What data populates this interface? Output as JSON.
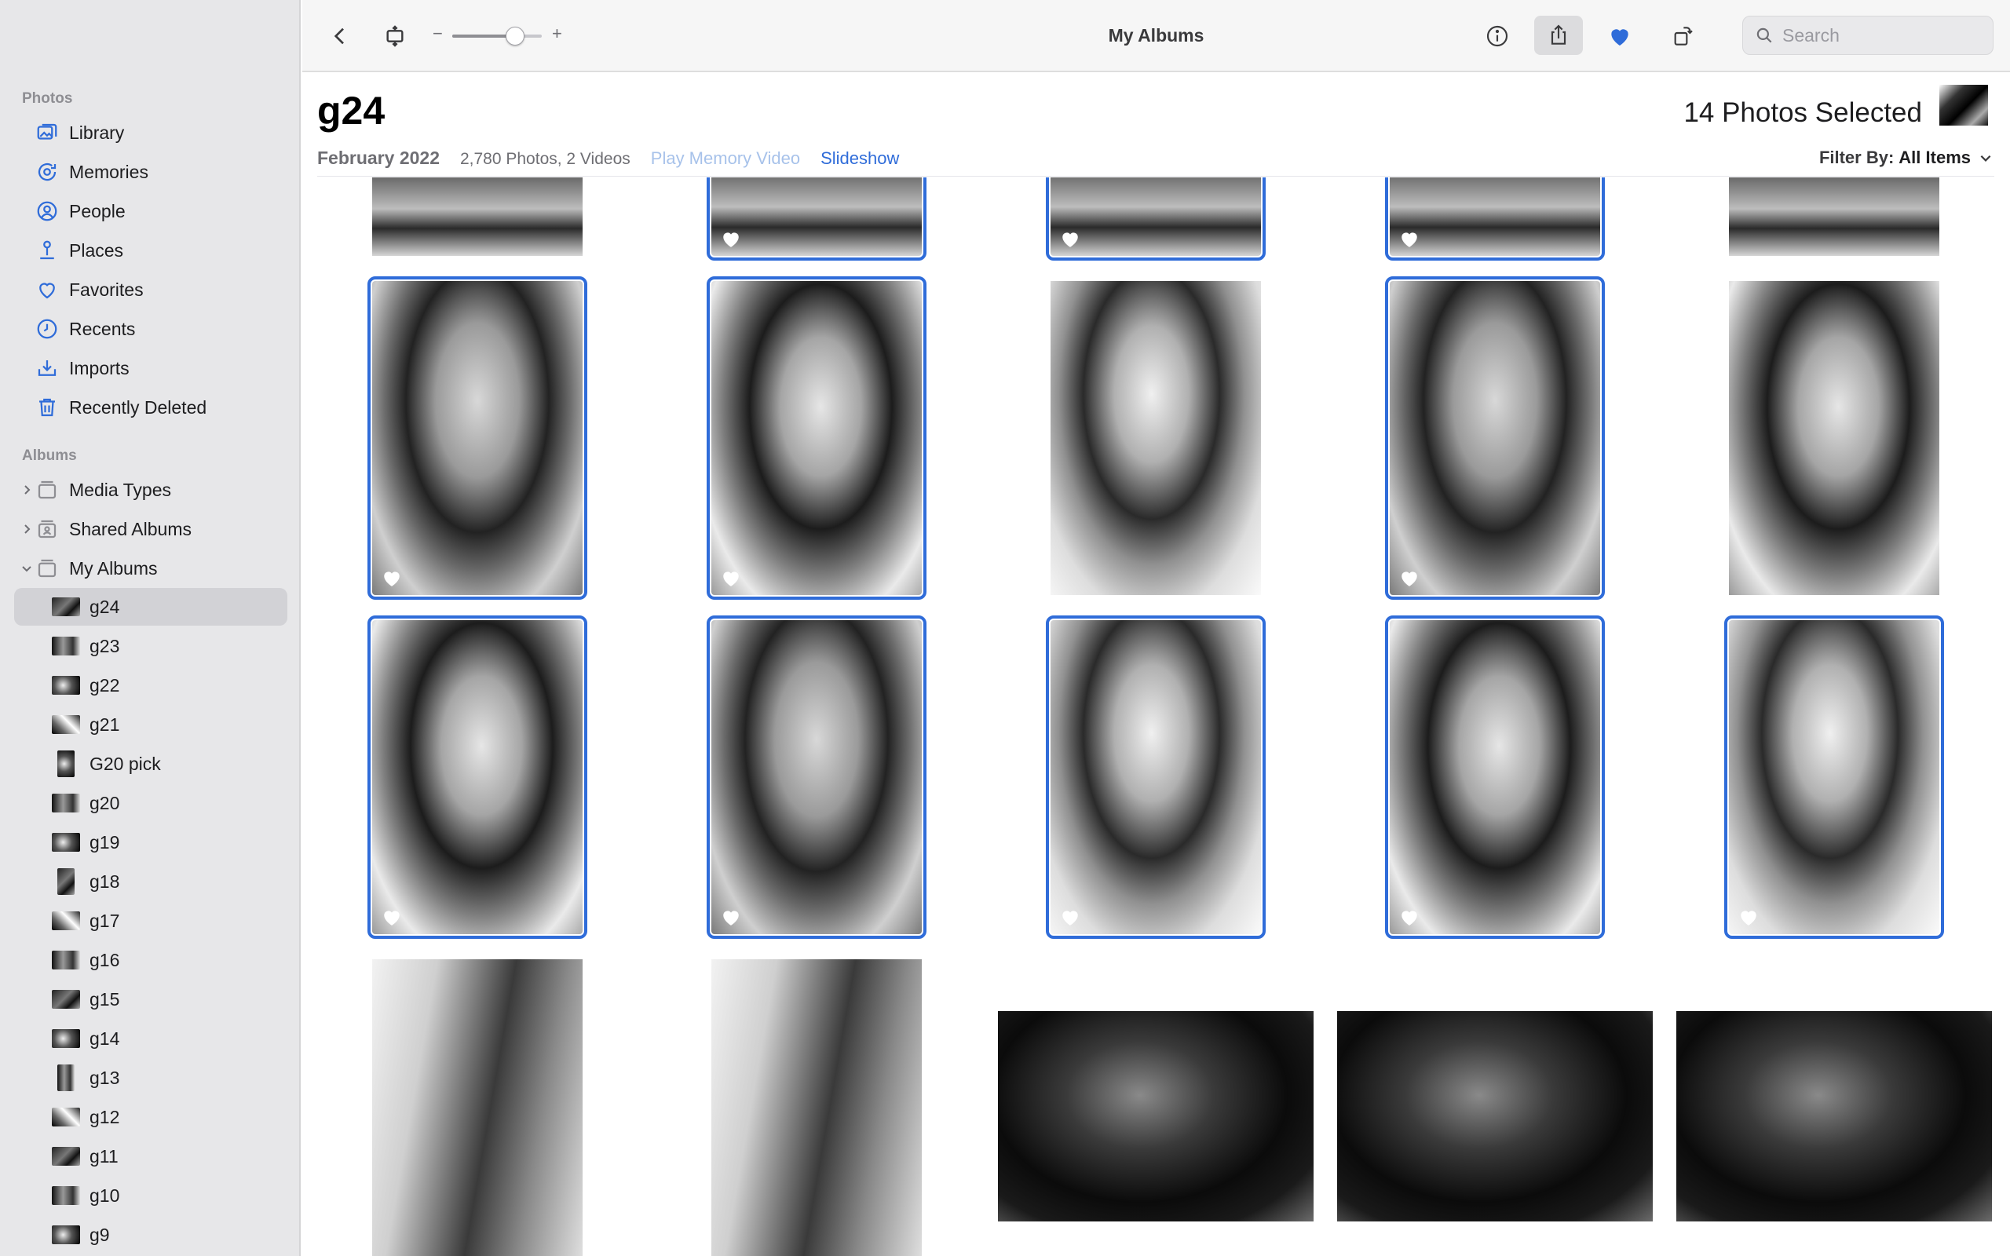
{
  "window": {
    "title": "My Albums"
  },
  "sidebar": {
    "photos_section": "Photos",
    "photos_items": [
      {
        "label": "Library",
        "icon": "library-icon"
      },
      {
        "label": "Memories",
        "icon": "memories-icon"
      },
      {
        "label": "People",
        "icon": "people-icon"
      },
      {
        "label": "Places",
        "icon": "places-icon"
      },
      {
        "label": "Favorites",
        "icon": "heart-icon"
      },
      {
        "label": "Recents",
        "icon": "clock-icon"
      },
      {
        "label": "Imports",
        "icon": "import-icon"
      },
      {
        "label": "Recently Deleted",
        "icon": "trash-icon"
      }
    ],
    "albums_section": "Albums",
    "album_groups": [
      {
        "label": "Media Types",
        "expanded": false
      },
      {
        "label": "Shared Albums",
        "expanded": false
      },
      {
        "label": "My Albums",
        "expanded": true
      }
    ],
    "my_albums": [
      {
        "label": "g24",
        "selected": true
      },
      {
        "label": "g23"
      },
      {
        "label": "g22"
      },
      {
        "label": "g21"
      },
      {
        "label": "G20 pick"
      },
      {
        "label": "g20"
      },
      {
        "label": "g19"
      },
      {
        "label": "g18"
      },
      {
        "label": "g17"
      },
      {
        "label": "g16"
      },
      {
        "label": "g15"
      },
      {
        "label": "g14"
      },
      {
        "label": "g13"
      },
      {
        "label": "g12"
      },
      {
        "label": "g11"
      },
      {
        "label": "g10"
      },
      {
        "label": "g9"
      }
    ]
  },
  "toolbar": {
    "zoom_minus": "−",
    "zoom_plus": "+",
    "zoom_level": 0.7,
    "search_placeholder": "Search"
  },
  "album": {
    "title": "g24",
    "date": "February 2022",
    "count": "2,780 Photos, 2 Videos",
    "play_memory": "Play Memory Video",
    "slideshow": "Slideshow",
    "selected_count": "14 Photos Selected",
    "filter_label": "Filter By:",
    "filter_value": "All Items"
  },
  "colors": {
    "accent": "#2f6cd9",
    "sidebar_bg": "#e7e7e9",
    "selected_row": "#d2d2d6"
  }
}
